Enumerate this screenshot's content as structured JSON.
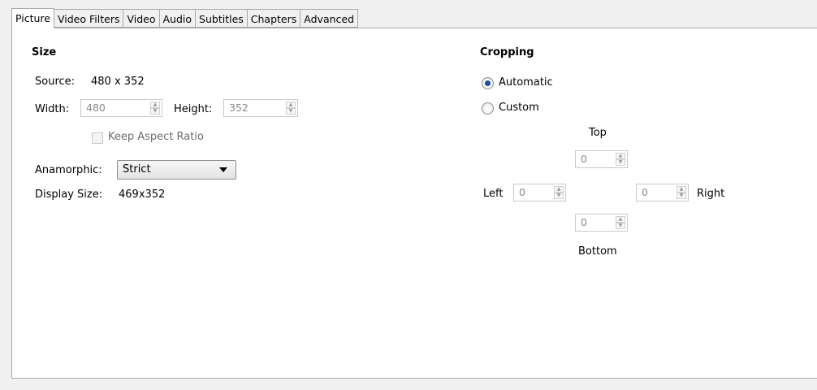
{
  "tabs": [
    {
      "label": "Picture",
      "active": true
    },
    {
      "label": "Video Filters"
    },
    {
      "label": "Video"
    },
    {
      "label": "Audio"
    },
    {
      "label": "Subtitles"
    },
    {
      "label": "Chapters"
    },
    {
      "label": "Advanced"
    }
  ],
  "size": {
    "heading": "Size",
    "source_label": "Source:",
    "source_value": "480 x 352",
    "width_label": "Width:",
    "width_value": "480",
    "height_label": "Height:",
    "height_value": "352",
    "keep_aspect_label": "Keep Aspect Ratio",
    "keep_aspect_checked": false,
    "anamorphic_label": "Anamorphic:",
    "anamorphic_value": "Strict",
    "display_size_label": "Display Size:",
    "display_size_value": "469x352"
  },
  "cropping": {
    "heading": "Cropping",
    "mode_automatic_label": "Automatic",
    "mode_custom_label": "Custom",
    "selected_mode": "Automatic",
    "top_label": "Top",
    "top_value": "0",
    "left_label": "Left",
    "left_value": "0",
    "right_label": "Right",
    "right_value": "0",
    "bottom_label": "Bottom",
    "bottom_value": "0"
  },
  "icons": {
    "spin_up": "▲",
    "spin_down": "▼"
  }
}
